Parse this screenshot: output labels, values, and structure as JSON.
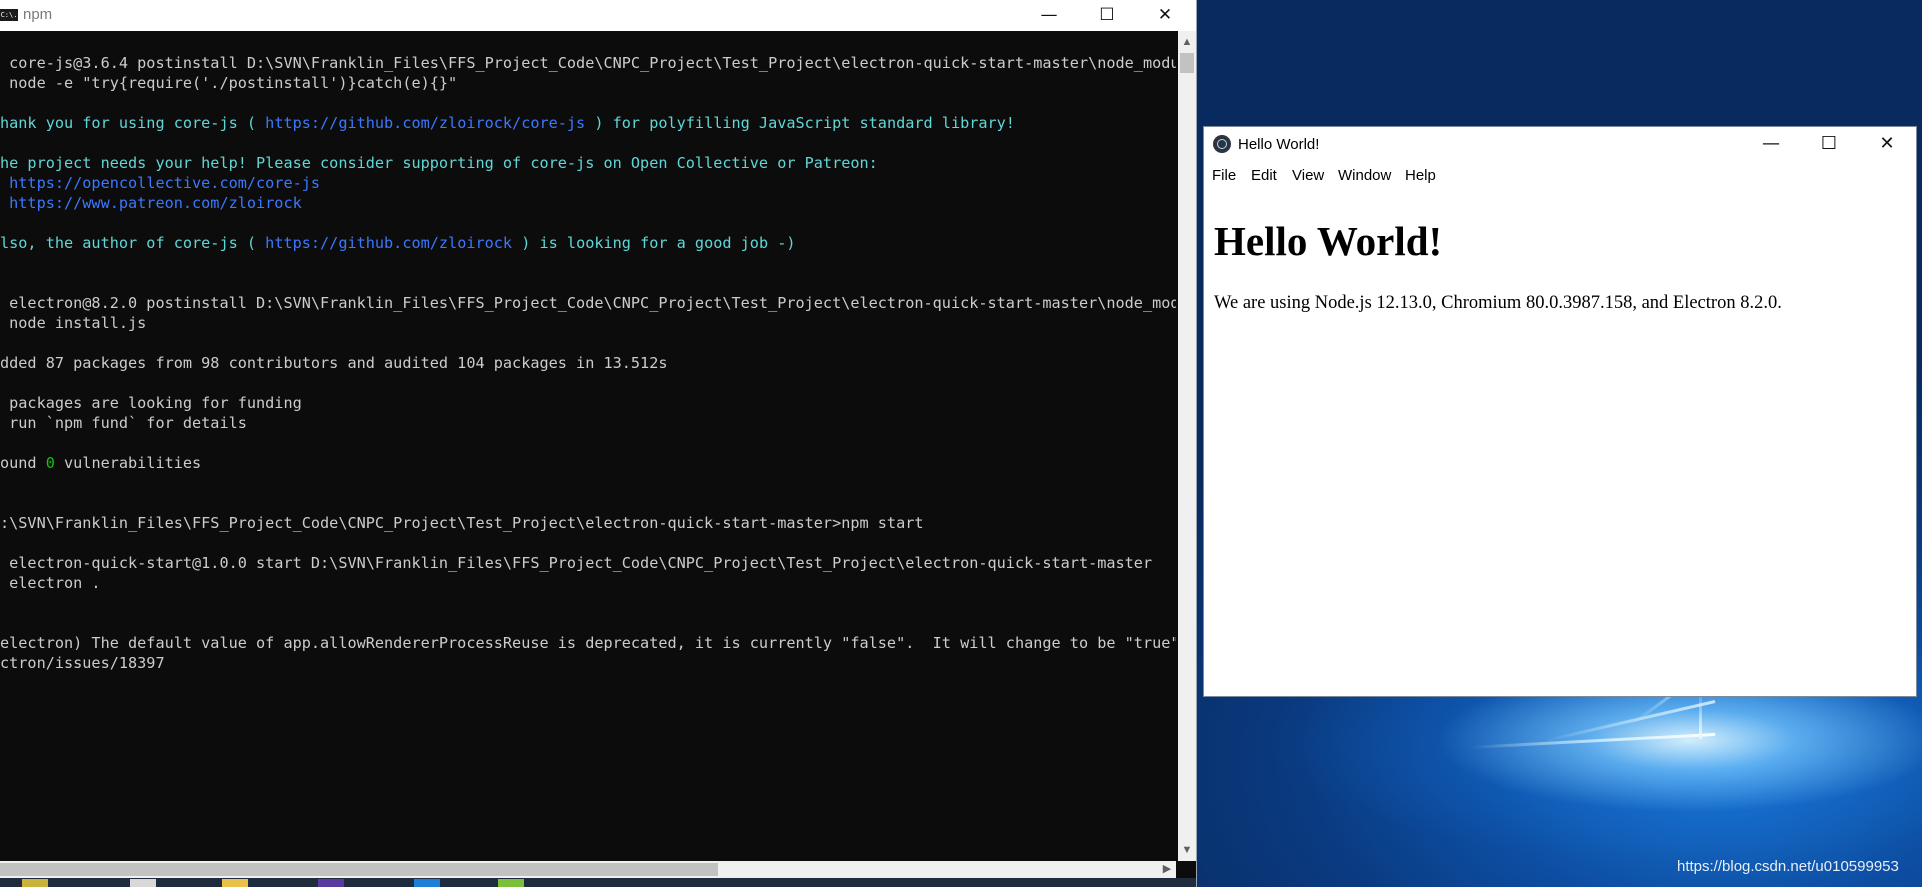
{
  "console": {
    "title": "npm",
    "icon_label": "C:\\.",
    "lines": [
      [
        {
          "t": " core-js@3.6.4 postinstall D:\\SVN\\Franklin_Files\\FFS_Project_Code\\CNPC_Project\\Test_Project\\electron-quick-start-master\\node_modul",
          "c": "#cccccc"
        }
      ],
      [
        {
          "t": " node -e \"try{require('./postinstall')}catch(e){}\"",
          "c": "#cccccc"
        }
      ],
      [],
      [
        {
          "t": "hank you for using core-js ( ",
          "c": "#61d6d6"
        },
        {
          "t": "https://github.com/zloirock/core-js",
          "c": "#3b78ff"
        },
        {
          "t": " ) for polyfilling JavaScript standard library!",
          "c": "#61d6d6"
        }
      ],
      [],
      [
        {
          "t": "he project needs your help! Please consider supporting of core-js on Open Collective or Patreon:",
          "c": "#61d6d6"
        }
      ],
      [
        {
          "t": " https://opencollective.com/core-js",
          "c": "#3b78ff"
        }
      ],
      [
        {
          "t": " https://www.patreon.com/zloirock",
          "c": "#3b78ff"
        }
      ],
      [],
      [
        {
          "t": "lso, the author of core-js ( ",
          "c": "#61d6d6"
        },
        {
          "t": "https://github.com/zloirock",
          "c": "#3b78ff"
        },
        {
          "t": " ) is looking for a good job -)",
          "c": "#61d6d6"
        }
      ],
      [],
      [],
      [
        {
          "t": " electron@8.2.0 postinstall D:\\SVN\\Franklin_Files\\FFS_Project_Code\\CNPC_Project\\Test_Project\\electron-quick-start-master\\node_modu",
          "c": "#cccccc"
        }
      ],
      [
        {
          "t": " node install.js",
          "c": "#cccccc"
        }
      ],
      [],
      [
        {
          "t": "dded 87 packages from 98 contributors and audited 104 packages in 13.512s",
          "c": "#cccccc"
        }
      ],
      [],
      [
        {
          "t": " packages are looking for funding",
          "c": "#cccccc"
        }
      ],
      [
        {
          "t": " run `npm fund` for details",
          "c": "#cccccc"
        }
      ],
      [],
      [
        {
          "t": "ound ",
          "c": "#cccccc"
        },
        {
          "t": "0",
          "c": "#13c10e"
        },
        {
          "t": " vulnerabilities",
          "c": "#cccccc"
        }
      ],
      [],
      [],
      [
        {
          "t": ":\\SVN\\Franklin_Files\\FFS_Project_Code\\CNPC_Project\\Test_Project\\electron-quick-start-master>npm start",
          "c": "#cccccc"
        }
      ],
      [],
      [
        {
          "t": " electron-quick-start@1.0.0 start D:\\SVN\\Franklin_Files\\FFS_Project_Code\\CNPC_Project\\Test_Project\\electron-quick-start-master",
          "c": "#cccccc"
        }
      ],
      [
        {
          "t": " electron .",
          "c": "#cccccc"
        }
      ],
      [],
      [],
      [
        {
          "t": "electron) The default value of app.allowRendererProcessReuse is deprecated, it is currently \"false\".  It will change to be \"true\"",
          "c": "#cccccc"
        }
      ],
      [
        {
          "t": "ctron/issues/18397",
          "c": "#cccccc"
        }
      ]
    ]
  },
  "app": {
    "title": "Hello World!",
    "menu": [
      "File",
      "Edit",
      "View",
      "Window",
      "Help"
    ],
    "heading": "Hello World!",
    "body": "We are using Node.js 12.13.0, Chromium 80.0.3987.158, and Electron 8.2.0."
  },
  "window_controls": {
    "minimize": "—",
    "maximize": "☐",
    "close": "✕"
  },
  "watermark": "https://blog.csdn.net/u010599953",
  "colors": {
    "console_bg": "#0c0c0c",
    "console_text": "#cccccc",
    "cyan_text": "#61d6d6",
    "link_blue": "#3b78ff",
    "success_green": "#13c10e",
    "desktop_blue": "#0a3c7e"
  }
}
